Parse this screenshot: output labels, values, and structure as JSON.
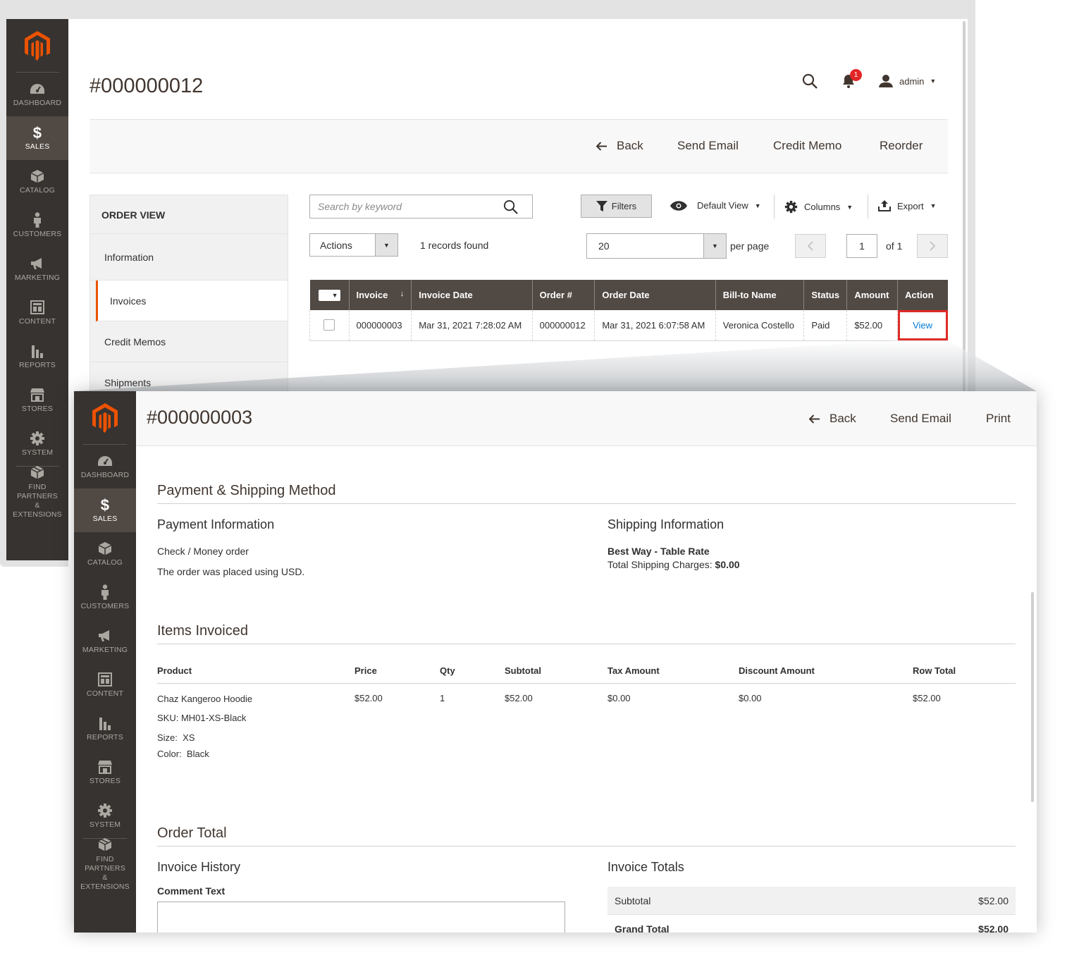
{
  "nav": {
    "items": [
      {
        "label": "DASHBOARD",
        "icon": "dashboard-icon"
      },
      {
        "label": "SALES",
        "icon": "dollar-icon"
      },
      {
        "label": "CATALOG",
        "icon": "cube-icon"
      },
      {
        "label": "CUSTOMERS",
        "icon": "person-icon"
      },
      {
        "label": "MARKETING",
        "icon": "megaphone-icon"
      },
      {
        "label": "CONTENT",
        "icon": "layout-icon"
      },
      {
        "label": "REPORTS",
        "icon": "bar-chart-icon"
      },
      {
        "label": "STORES",
        "icon": "storefront-icon"
      },
      {
        "label": "SYSTEM",
        "icon": "gear-icon"
      }
    ],
    "partners_line1": "FIND PARTNERS",
    "partners_line2": "& EXTENSIONS"
  },
  "order": {
    "title": "#000000012",
    "notification_count": "1",
    "user": "admin",
    "actions": {
      "back": "Back",
      "send_email": "Send Email",
      "credit_memo": "Credit Memo",
      "reorder": "Reorder"
    },
    "order_view": {
      "title": "ORDER VIEW",
      "tabs": [
        "Information",
        "Invoices",
        "Credit Memos",
        "Shipments"
      ]
    },
    "grid": {
      "search_placeholder": "Search by keyword",
      "filters": "Filters",
      "default_view": "Default View",
      "columns": "Columns",
      "export": "Export",
      "actions": "Actions",
      "records_found": "1 records found",
      "per_page_value": "20",
      "per_page_label": "per page",
      "page": "1",
      "page_of": "of 1",
      "headers": [
        "Invoice",
        "Invoice Date",
        "Order #",
        "Order Date",
        "Bill-to Name",
        "Status",
        "Amount",
        "Action"
      ],
      "sort_indicator": "↓",
      "row": {
        "invoice": "000000003",
        "invoice_date": "Mar 31, 2021 7:28:02 AM",
        "order": "000000012",
        "order_date": "Mar 31, 2021 6:07:58 AM",
        "bill_to": "Veronica Costello",
        "status": "Paid",
        "amount": "$52.00",
        "action": "View"
      }
    }
  },
  "invoice": {
    "title": "#000000003",
    "actions": {
      "back": "Back",
      "send_email": "Send Email",
      "print": "Print"
    },
    "payment_shipping_title": "Payment & Shipping Method",
    "payment_info_title": "Payment Information",
    "payment_method": "Check / Money order",
    "currency_note": "The order was placed using USD.",
    "shipping_info_title": "Shipping Information",
    "shipping_method": "Best Way - Table Rate",
    "shipping_charges_label": "Total Shipping Charges:",
    "shipping_charges_value": "$0.00",
    "items_title": "Items Invoiced",
    "items_headers": [
      "Product",
      "Price",
      "Qty",
      "Subtotal",
      "Tax Amount",
      "Discount Amount",
      "Row Total"
    ],
    "item": {
      "name": "Chaz Kangeroo Hoodie",
      "sku": "SKU: MH01-XS-Black",
      "size": "Size:  XS",
      "color": "Color:  Black",
      "price": "$52.00",
      "qty": "1",
      "subtotal": "$52.00",
      "tax": "$0.00",
      "discount": "$0.00",
      "row_total": "$52.00"
    },
    "order_total_title": "Order Total",
    "history_title": "Invoice History",
    "comment_label": "Comment Text",
    "totals_title": "Invoice Totals",
    "subtotal_label": "Subtotal",
    "subtotal_value": "$52.00",
    "grand_total_label": "Grand Total",
    "grand_total_value": "$52.00"
  },
  "colors": {
    "nav_bg": "#373330",
    "nav_active": "#514943",
    "accent": "#eb5202",
    "highlight": "#e02b27",
    "link": "#007bdb"
  }
}
